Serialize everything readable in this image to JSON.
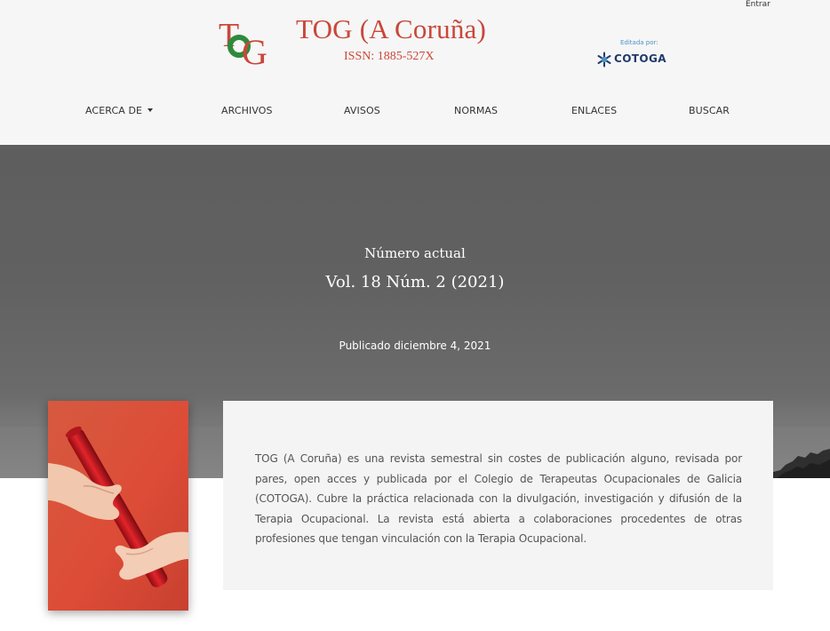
{
  "header": {
    "login_label": "Entrar",
    "brand": {
      "logo_letters": "TOG",
      "title": "TOG (A Coruña)",
      "issn": "ISSN: 1885-527X"
    },
    "publisher": {
      "label": "Editada por:",
      "name": "COTOGA"
    }
  },
  "nav": {
    "items": [
      {
        "label": "ACERCA DE",
        "has_dropdown": true
      },
      {
        "label": "ARCHIVOS"
      },
      {
        "label": "AVISOS"
      },
      {
        "label": "NORMAS"
      },
      {
        "label": "ENLACES"
      },
      {
        "label": "BUSCAR"
      }
    ]
  },
  "hero": {
    "kicker": "Número actual",
    "issue": "Vol. 18 Núm. 2 (2021)",
    "published": "Publicado diciembre 4, 2021"
  },
  "issue": {
    "description": "TOG (A Coruña) es una revista semestral sin costes de publicación alguno, revisada por pares, open acces y publicada por el Colegio de Terapeutas Ocupacionales de Galicia (COTOGA). Cubre la práctica relacionada con la divulgación, investigación y difusión de la Terapia Ocupacional. La revista está abierta a colaboraciones procedentes de otras profesiones que tengan vinculación con la Terapia Ocupacional."
  },
  "colors": {
    "brand_red": "#c9473a",
    "brand_green": "#2f8a3c",
    "header_bg": "#f6f6f6",
    "hero_bg": "#616161",
    "cover_red": "#d9493a"
  },
  "icons": {
    "logo": "tog-monogram-logo",
    "publisher": "snowflake-logo-icon",
    "dropdown": "caret-down-icon"
  }
}
